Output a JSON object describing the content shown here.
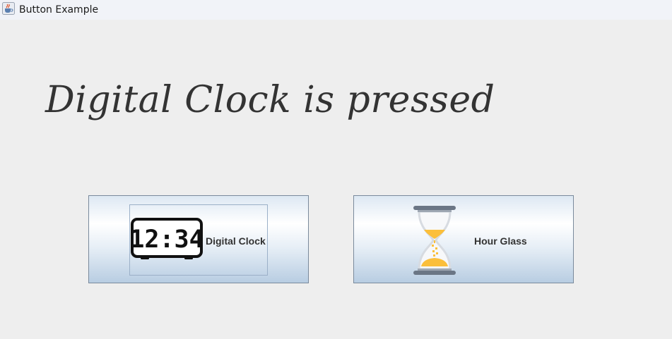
{
  "window": {
    "title": "Button Example",
    "icon": "java-cup-icon"
  },
  "status": {
    "text": "Digital Clock is pressed"
  },
  "buttons": [
    {
      "label": "Digital Clock",
      "icon": "digital-clock-icon",
      "clock_display": "12:34",
      "focused": true
    },
    {
      "label": "Hour Glass",
      "icon": "hourglass-icon",
      "focused": false
    }
  ],
  "colors": {
    "background": "#eeeeee",
    "button_border": "#7a8a9c",
    "sand": "#fbbf3b",
    "hourglass_frame": "#6b7685"
  }
}
